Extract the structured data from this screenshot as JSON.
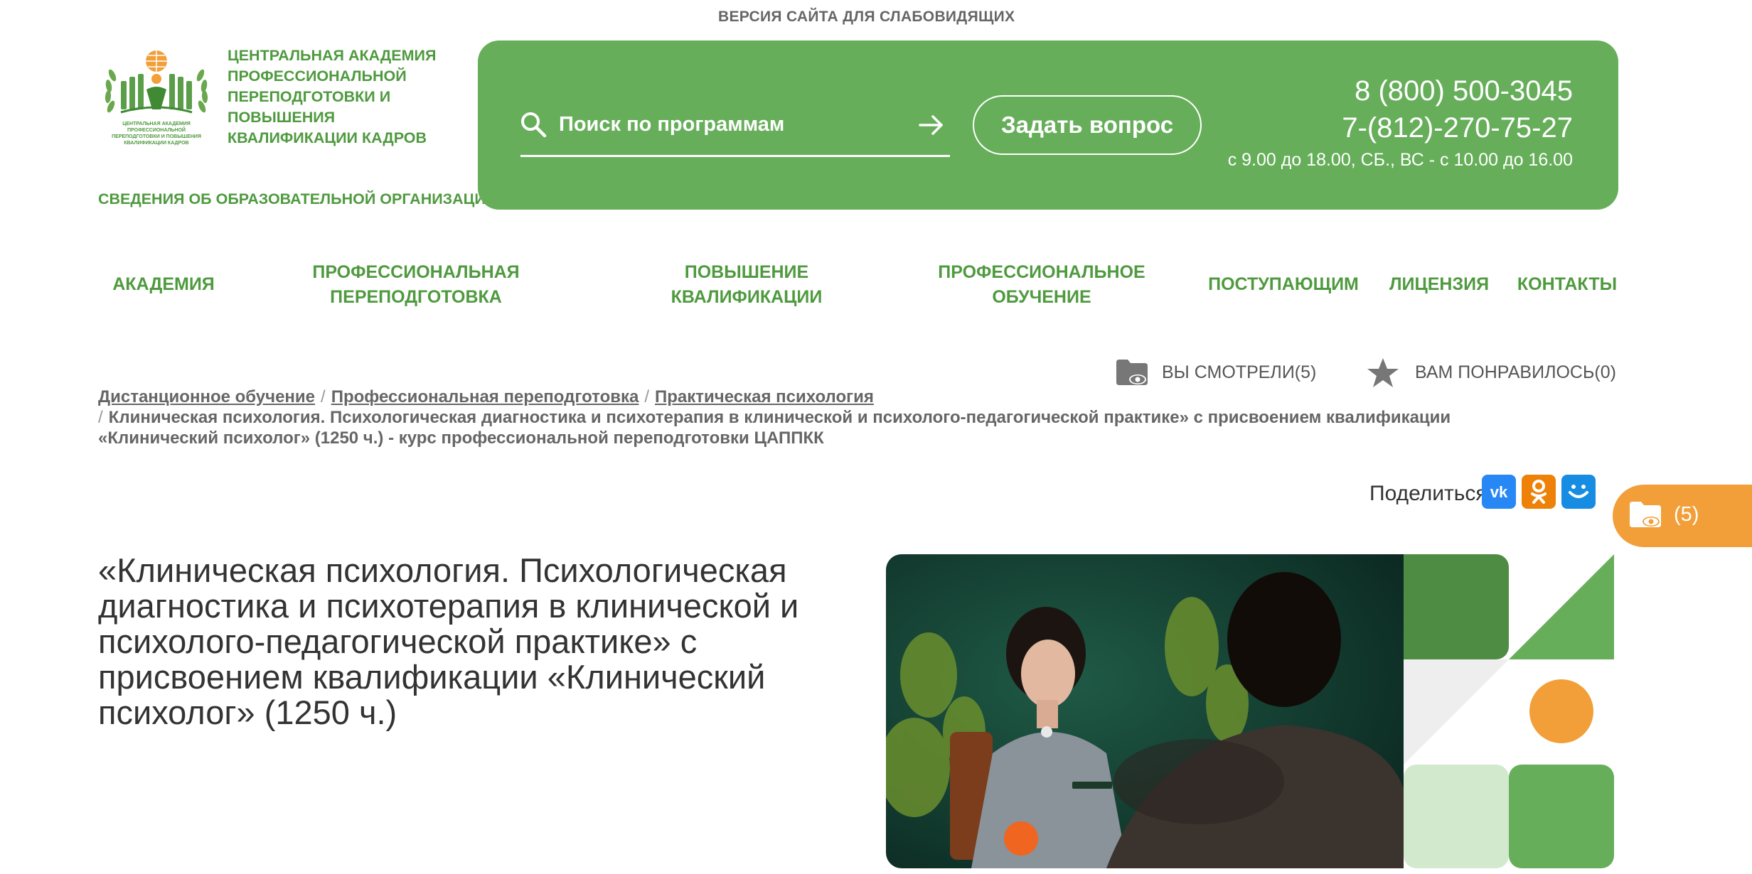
{
  "header": {
    "vision_version": "ВЕРСИЯ САЙТА ДЛЯ СЛАБОВИДЯЩИХ",
    "logo_small_text": "ЦЕНТРАЛЬНАЯ АКАДЕМИЯ ПРОФЕССИОНАЛЬНОЙ ПЕРЕПОДГОТОВКИ И ПОВЫШЕНИЯ КВАЛИФИКАЦИИ КАДРОВ",
    "logo_title": "ЦЕНТРАЛЬНАЯ АКАДЕМИЯ ПРОФЕССИОНАЛЬНОЙ ПЕРЕПОДГОТОВКИ И ПОВЫШЕНИЯ КВАЛИФИКАЦИИ КАДРОВ",
    "org_info": "СВЕДЕНИЯ ОБ ОБРАЗОВАТЕЛЬНОЙ ОРГАНИЗАЦИИ",
    "search_placeholder": "Поиск по программам",
    "ask_button": "Задать вопрос",
    "phone_1": "8 (800) 500-3045",
    "phone_2": "7-(812)-270-75-27",
    "hours": "с 9.00 до 18.00, СБ., ВС - с 10.00 до 16.00"
  },
  "nav": [
    {
      "line1": "АКАДЕМИЯ",
      "line2": ""
    },
    {
      "line1": "ПРОФЕССИОНАЛЬНАЯ",
      "line2": "ПЕРЕПОДГОТОВКА"
    },
    {
      "line1": "ПОВЫШЕНИЕ",
      "line2": "КВАЛИФИКАЦИИ"
    },
    {
      "line1": "ПРОФЕССИОНАЛЬНОЕ",
      "line2": "ОБУЧЕНИЕ"
    },
    {
      "line1": "ПОСТУПАЮЩИМ",
      "line2": ""
    },
    {
      "line1": "ЛИЦЕНЗИЯ",
      "line2": ""
    },
    {
      "line1": "КОНТАКТЫ",
      "line2": ""
    }
  ],
  "user_lists": {
    "viewed": "ВЫ СМОТРЕЛИ(5)",
    "liked": "ВАМ ПОНРАВИЛОСЬ(0)"
  },
  "breadcrumbs": {
    "links": [
      "Дистанционное обучение",
      "Профессиональная переподготовка",
      "Практическая психология"
    ],
    "current": "Клиническая психология. Психологическая диагностика и психотерапия в клинической и психолого-педагогической практике» с присвоением квалификации «Клинический психолог» (1250 ч.) - курс профессиональной переподготовки ЦАППКК",
    "separator": "/"
  },
  "share": {
    "label": "Поделиться:",
    "buttons": [
      {
        "name": "vk",
        "text": "vk",
        "color": "#2787f5"
      },
      {
        "name": "ok",
        "text": "ok",
        "color": "#ee8208"
      },
      {
        "name": "mymail",
        "text": "",
        "color": "#168de2"
      }
    ]
  },
  "viewed_badge": {
    "count": "(5)"
  },
  "course": {
    "title": "«Клиническая психология. Психологическая диагностика и психотерапия в клинической и психолого-педагогической практике» с присвоением квалификации «Клинический психолог» (1250 ч.)"
  },
  "colors": {
    "brand_green": "#66ae5a",
    "text_green": "#4f9a3f",
    "accent_orange": "#f29f39"
  }
}
